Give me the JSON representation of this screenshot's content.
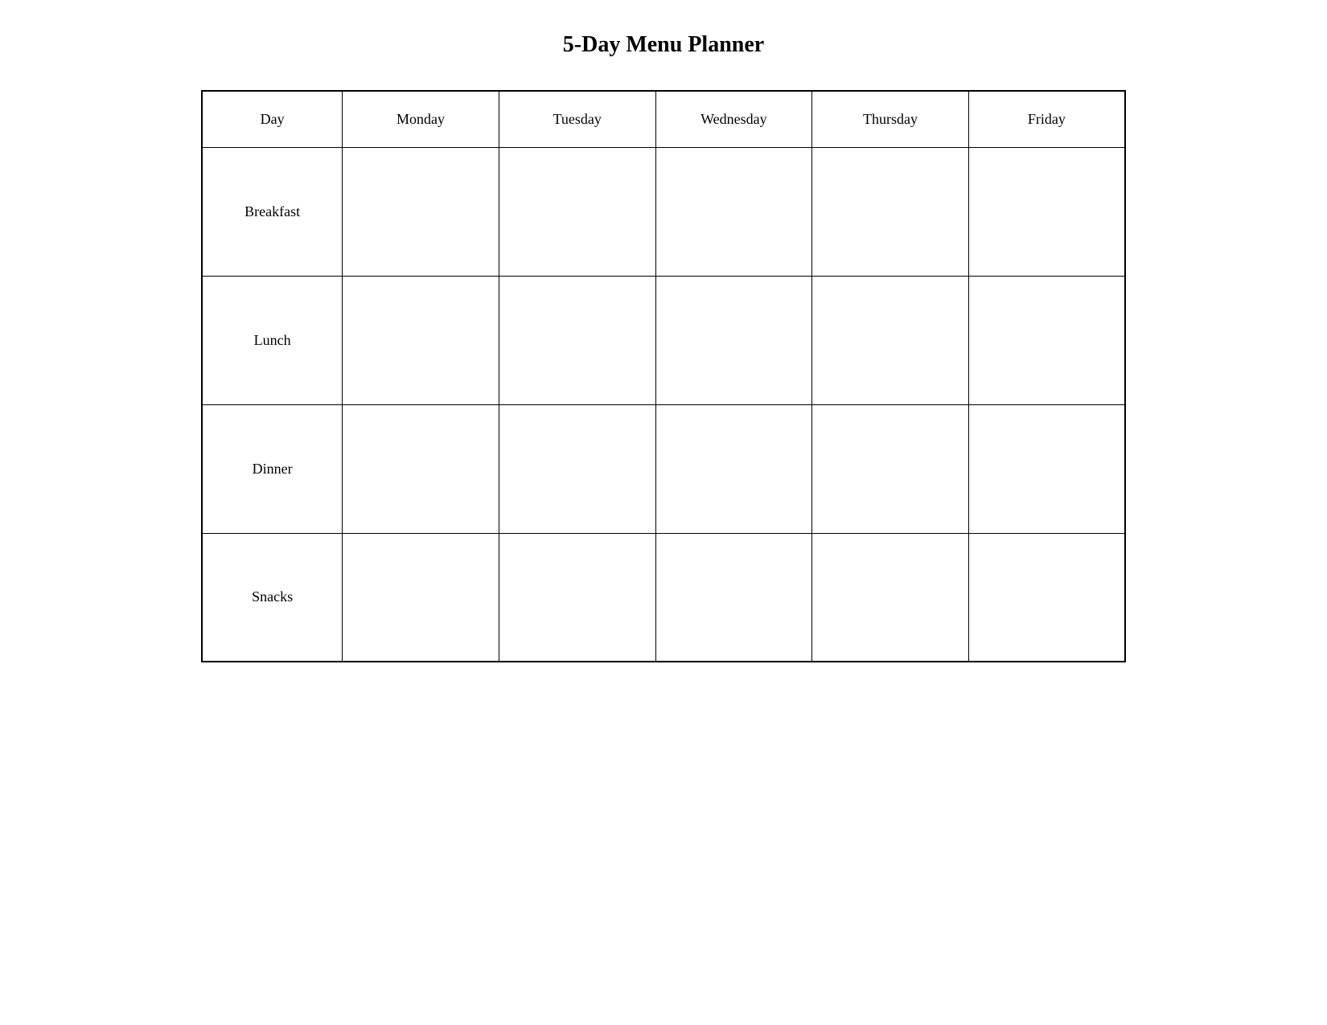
{
  "title": "5-Day Menu Planner",
  "columns": {
    "day": "Day",
    "monday": "Monday",
    "tuesday": "Tuesday",
    "wednesday": "Wednesday",
    "thursday": "Thursday",
    "friday": "Friday"
  },
  "rows": [
    {
      "label": "Breakfast"
    },
    {
      "label": "Lunch"
    },
    {
      "label": "Dinner"
    },
    {
      "label": "Snacks"
    }
  ]
}
